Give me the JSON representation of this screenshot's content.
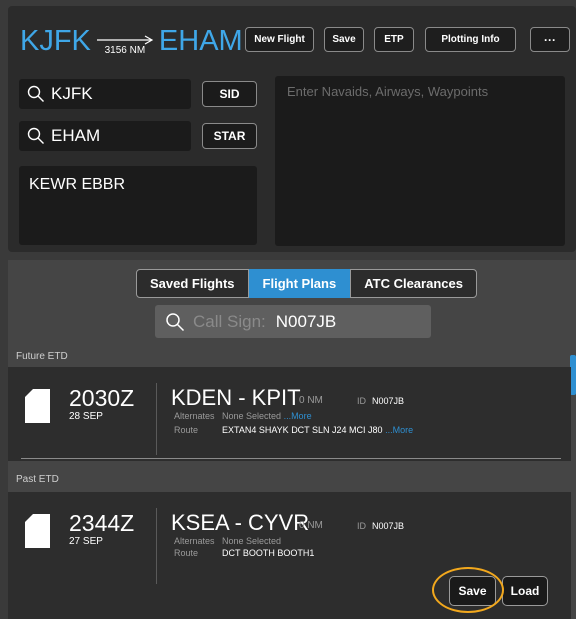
{
  "header": {
    "origin": "KJFK",
    "destination": "EHAM",
    "distance": "3156 NM",
    "buttons": {
      "new_flight": "New Flight",
      "save": "Save",
      "etp": "ETP",
      "plotting_info": "Plotting Info",
      "more": "···"
    }
  },
  "route_inputs": {
    "departure": "KJFK",
    "sid": "SID",
    "arrival": "EHAM",
    "star": "STAR",
    "alternates": "KEWR EBBR",
    "navaids_placeholder": "Enter Navaids, Airways, Waypoints"
  },
  "tabs": [
    "Saved Flights",
    "Flight Plans",
    "ATC Clearances"
  ],
  "active_tab": "Flight Plans",
  "search": {
    "label": "Call Sign:",
    "value": "N007JB"
  },
  "sections": {
    "future": "Future ETD",
    "past": "Past ETD"
  },
  "flights": [
    {
      "time": "2030Z",
      "date": "28 SEP",
      "pair": "KDEN - KPIT",
      "distance": "0 NM",
      "id_label": "ID",
      "id": "N007JB",
      "alternates_label": "Alternates",
      "alternates": "None Selected",
      "alternates_more": "...More",
      "route_label": "Route",
      "route": "EXTAN4 SHAYK DCT SLN J24 MCI J80",
      "route_more": "...More"
    },
    {
      "time": "2344Z",
      "date": "27 SEP",
      "pair": "KSEA - CYVR",
      "distance": "0 NM",
      "id_label": "ID",
      "id": "N007JB",
      "alternates_label": "Alternates",
      "alternates": "None Selected",
      "route_label": "Route",
      "route": "DCT BOOTH BOOTH1",
      "save_label": "Save",
      "load_label": "Load"
    }
  ],
  "colors": {
    "accent": "#2e8fd1",
    "title": "#3fa7e8",
    "highlight": "#f2a81d"
  }
}
